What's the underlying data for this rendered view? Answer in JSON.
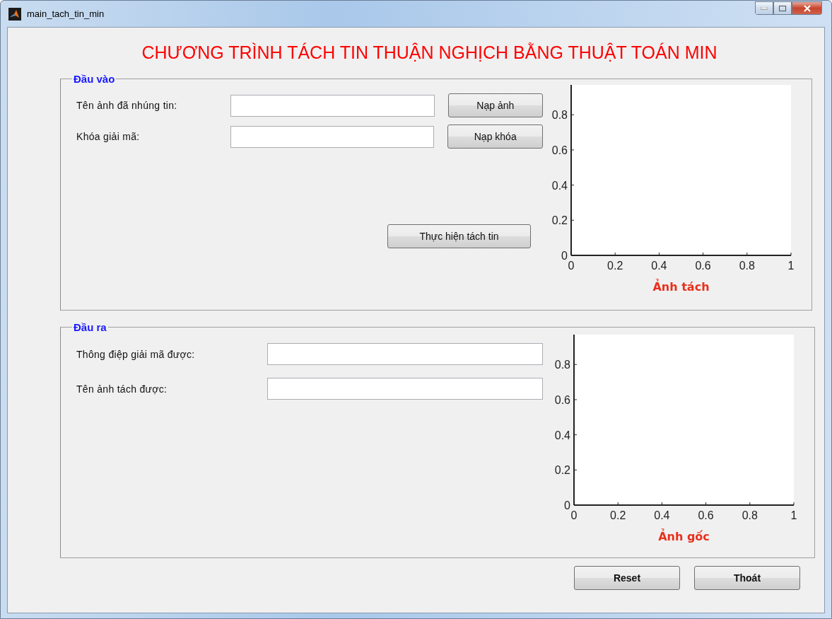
{
  "window": {
    "title": "main_tach_tin_min"
  },
  "heading": "CHƯƠNG TRÌNH TÁCH TIN THUẬN NGHỊCH BẰNG THUẬT TOÁN MIN",
  "input_panel": {
    "title": "Đầu vào",
    "rows": [
      {
        "label": "Tên ảnh đã nhúng tin:",
        "button": "Nạp ảnh"
      },
      {
        "label": "Khóa giải mã:",
        "button": "Nạp khóa"
      }
    ],
    "run_button": "Thực hiện tách tin",
    "chart_data": {
      "type": "scatter",
      "xlabel": "Ảnh tách",
      "xlim": [
        0,
        1
      ],
      "ylim": [
        0,
        0.97
      ],
      "xticks": [
        0,
        0.2,
        0.4,
        0.6,
        0.8,
        1
      ],
      "yticks": [
        0,
        0.2,
        0.4,
        0.6,
        0.8
      ]
    }
  },
  "output_panel": {
    "title": "Đầu ra",
    "rows": [
      {
        "label": "Thông điệp giải mã được:"
      },
      {
        "label": "Tên ảnh tách được:"
      }
    ],
    "chart_data": {
      "type": "scatter",
      "xlabel": "Ảnh gốc",
      "xlim": [
        0,
        1
      ],
      "ylim": [
        0,
        0.97
      ],
      "xticks": [
        0,
        0.2,
        0.4,
        0.6,
        0.8,
        1
      ],
      "yticks": [
        0,
        0.2,
        0.4,
        0.6,
        0.8
      ]
    }
  },
  "buttons": [
    "Reset",
    "Thoát"
  ]
}
